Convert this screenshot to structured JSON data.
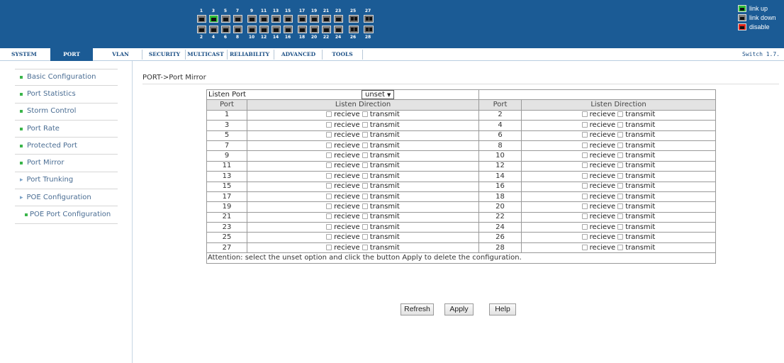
{
  "header": {
    "ports_top": [
      "1",
      "3",
      "5",
      "7",
      "9",
      "11",
      "13",
      "15",
      "17",
      "19",
      "21",
      "23",
      "25",
      "27"
    ],
    "ports_bottom": [
      "2",
      "4",
      "6",
      "8",
      "10",
      "12",
      "14",
      "16",
      "18",
      "20",
      "22",
      "24",
      "26",
      "28"
    ],
    "port_status_up": [
      "3"
    ],
    "colors": {
      "banner": "#1b5b95",
      "link_up": "#2fbf3a",
      "link_down": "#777777",
      "disable": "#e0241b"
    },
    "legend": {
      "up": {
        "label": "link up",
        "icon": "link-up-icon"
      },
      "down": {
        "label": "link down",
        "icon": "link-down-icon"
      },
      "disable": {
        "label": "disable",
        "icon": "disable-icon"
      }
    }
  },
  "tabs": [
    {
      "label": "SYSTEM"
    },
    {
      "label": "PORT",
      "active": true
    },
    {
      "label": "VLAN"
    },
    {
      "label": "SECURITY"
    },
    {
      "label": "MULTICAST"
    },
    {
      "label": "RELIABILITY"
    },
    {
      "label": "ADVANCED"
    },
    {
      "label": "TOOLS"
    }
  ],
  "version": "Switch 1.7.",
  "sidebar": [
    {
      "label": "Basic Configuration",
      "bullet": "square"
    },
    {
      "label": "Port Statistics",
      "bullet": "square"
    },
    {
      "label": "Storm Control",
      "bullet": "square"
    },
    {
      "label": "Port Rate",
      "bullet": "square"
    },
    {
      "label": "Protected Port",
      "bullet": "square"
    },
    {
      "label": "Port Mirror",
      "bullet": "square"
    },
    {
      "label": "Port Trunking",
      "bullet": "arrow"
    },
    {
      "label": "POE Configuration",
      "bullet": "arrow"
    },
    {
      "label": "POE Port Configuration",
      "bullet": "square",
      "sub": true
    }
  ],
  "breadcrumb": "PORT->Port Mirror",
  "listen_port": {
    "label": "Listen Port",
    "value": "unset"
  },
  "table": {
    "headers": {
      "port": "Port",
      "direction": "Listen Direction"
    },
    "recieve_label": "recieve",
    "transmit_label": "transmit",
    "rows": [
      [
        "1",
        "2"
      ],
      [
        "3",
        "4"
      ],
      [
        "5",
        "6"
      ],
      [
        "7",
        "8"
      ],
      [
        "9",
        "10"
      ],
      [
        "11",
        "12"
      ],
      [
        "13",
        "14"
      ],
      [
        "15",
        "16"
      ],
      [
        "17",
        "18"
      ],
      [
        "19",
        "20"
      ],
      [
        "21",
        "22"
      ],
      [
        "23",
        "24"
      ],
      [
        "25",
        "26"
      ],
      [
        "27",
        "28"
      ]
    ],
    "note": "Attention: select the unset option and click the button Apply to delete the configuration."
  },
  "buttons": {
    "refresh": "Refresh",
    "apply": "Apply",
    "help": "Help"
  }
}
